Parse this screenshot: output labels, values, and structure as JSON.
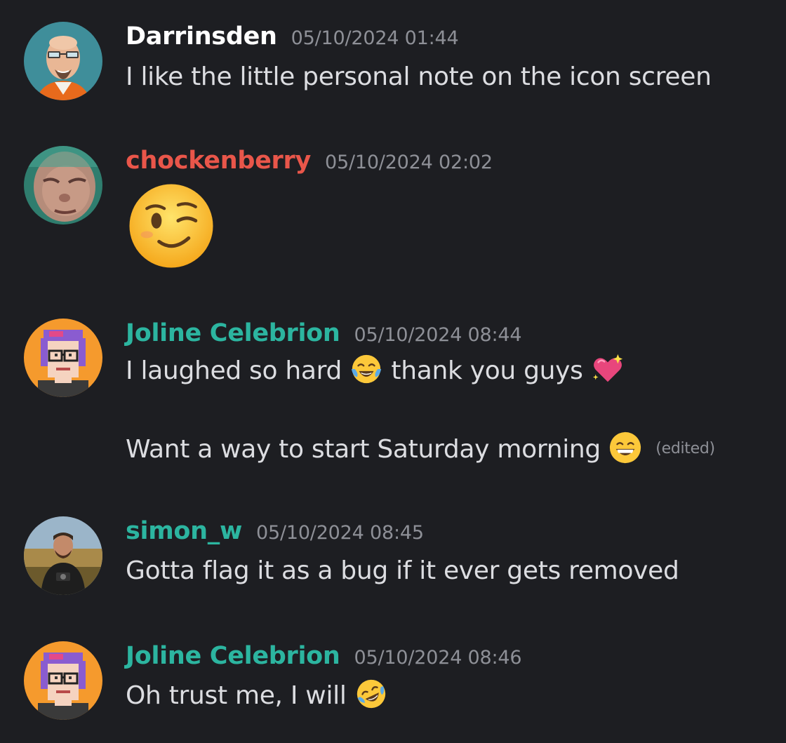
{
  "colors": {
    "background": "#1d1e22",
    "text": "#dcdde1",
    "timestamp": "#8e9097",
    "user_white": "#ffffff",
    "user_red": "#e9564a",
    "user_teal": "#2cb5a0"
  },
  "messages": [
    {
      "username": "Darrinsden",
      "timestamp": "05/10/2024 01:44",
      "avatar": "cartoon-bald-man-glasses-avatar",
      "lines": [
        "I like the little personal note on the icon screen"
      ]
    },
    {
      "username": "chockenberry",
      "timestamp": "05/10/2024 02:02",
      "avatar": "photo-squinting-face-avatar",
      "emoji": "winking-face-emoji"
    },
    {
      "username": "Joline Celebrion",
      "timestamp": "05/10/2024 08:44",
      "avatar": "pixel-art-purple-hair-glasses-avatar",
      "lines": [
        {
          "text_1": "I laughed so hard",
          "emoji_1": "tears-of-joy-emoji",
          "text_2": "thank you guys",
          "emoji_2": "sparkling-heart-emoji"
        },
        {
          "text_1": "Want a way to start Saturday morning",
          "emoji_1": "grinning-face-emoji",
          "edited": "(edited)"
        }
      ]
    },
    {
      "username": "simon_w",
      "timestamp": "05/10/2024 08:45",
      "avatar": "photo-man-with-camera-avatar",
      "lines": [
        "Gotta flag it as a bug if it ever gets removed"
      ]
    },
    {
      "username": "Joline Celebrion",
      "timestamp": "05/10/2024 08:46",
      "avatar": "pixel-art-purple-hair-glasses-avatar",
      "lines": [
        {
          "text_1": "Oh trust me, I will",
          "emoji_1": "rolling-on-floor-laughing-emoji"
        }
      ]
    }
  ]
}
